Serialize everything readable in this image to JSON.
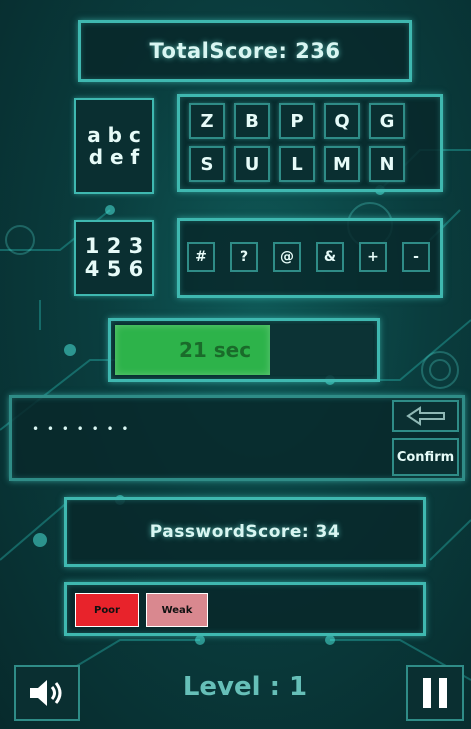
{
  "header": {
    "total_score": "TotalScore: 236"
  },
  "mode_buttons": {
    "letters": "a b c\nd e f",
    "numbers": "1 2 3\n4 5 6"
  },
  "letter_keys": [
    "Z",
    "B",
    "P",
    "Q",
    "G",
    "S",
    "U",
    "L",
    "M",
    "N"
  ],
  "symbol_keys": [
    "#",
    "?",
    "@",
    "&",
    "+",
    "-"
  ],
  "timer": {
    "label": "21 sec",
    "progress": 0.6,
    "bar_color": "#2db34a"
  },
  "password": {
    "masked": "• • • • • • •",
    "confirm_label": "Confirm"
  },
  "password_score": {
    "label": "PasswordScore: 34"
  },
  "strength": {
    "items": [
      {
        "label": "Poor",
        "color": "#e8232b"
      },
      {
        "label": "Weak",
        "color": "#d9888f"
      }
    ]
  },
  "footer": {
    "level": "Level : 1"
  },
  "icons": {
    "sound": "speaker-icon",
    "pause": "pause-icon",
    "backspace": "backspace-arrow-icon"
  }
}
